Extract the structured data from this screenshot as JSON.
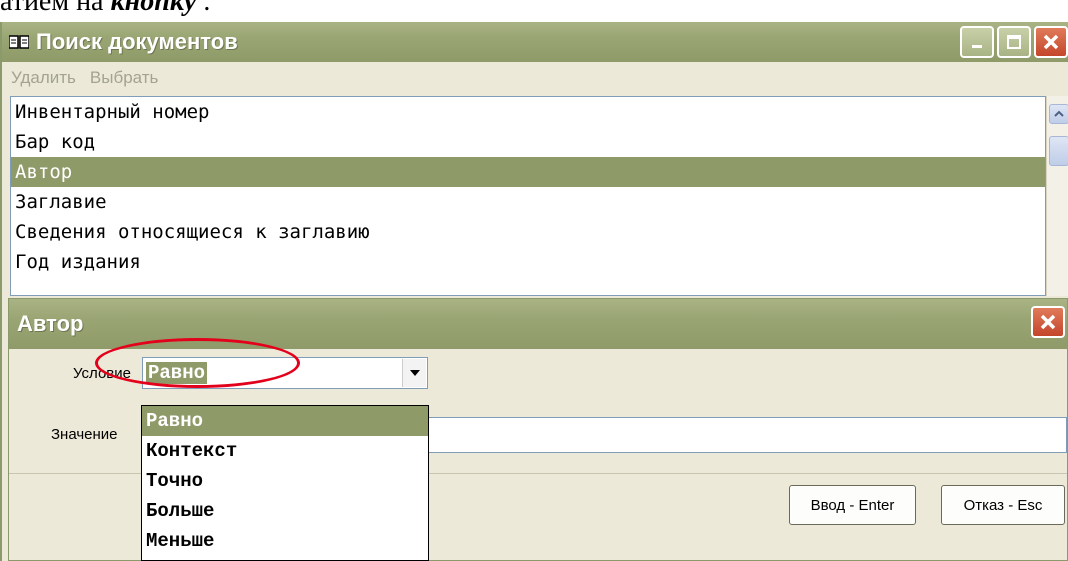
{
  "doc_fragment": {
    "prefix": "атием на ",
    "emph": "кнопку",
    "suffix": " ."
  },
  "main_window": {
    "title": "Поиск документов",
    "menu": [
      "Удалить",
      "Выбрать"
    ],
    "list_items": [
      "Инвентарный номер",
      "Бар код",
      "Автор",
      "Заглавие",
      "Сведения относящиеся к заглавию",
      "Год издания"
    ],
    "selected_index": 2
  },
  "dialog": {
    "title": "Автор",
    "condition_label": "Условие",
    "condition_value": "Равно",
    "value_label": "Значение",
    "value": "",
    "enter_button": "Ввод - Enter",
    "esc_button": "Отказ - Esc",
    "condition_options": [
      "Равно",
      "Контекст",
      "Точно",
      "Больше",
      "Меньше"
    ]
  },
  "colors": {
    "titlebar": "#9aa574",
    "selection": "#8f9a69",
    "annotation": "#e3001b",
    "close": "#c4462b"
  }
}
